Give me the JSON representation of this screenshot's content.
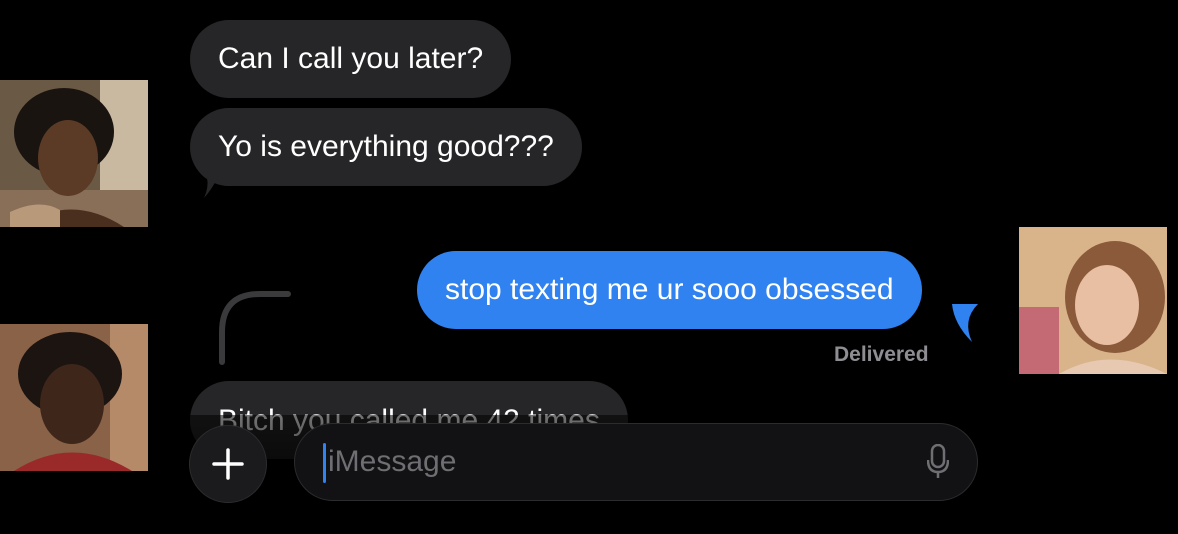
{
  "conversation": {
    "messages": [
      {
        "sender": "other",
        "text": "Can I call you later?"
      },
      {
        "sender": "other",
        "text": "Yo is everything good???"
      },
      {
        "sender": "me",
        "text": "stop texting me ur sooo obsessed"
      },
      {
        "sender": "other",
        "text": "Bitch you called me 42 times"
      }
    ],
    "status": "Delivered"
  },
  "compose": {
    "placeholder": "iMessage",
    "plus_icon": "plus-icon",
    "mic_icon": "microphone-icon"
  },
  "colors": {
    "background": "#000000",
    "incoming_bubble": "#262628",
    "outgoing_bubble": "#2f82f0",
    "status_text": "#8d8d92"
  }
}
